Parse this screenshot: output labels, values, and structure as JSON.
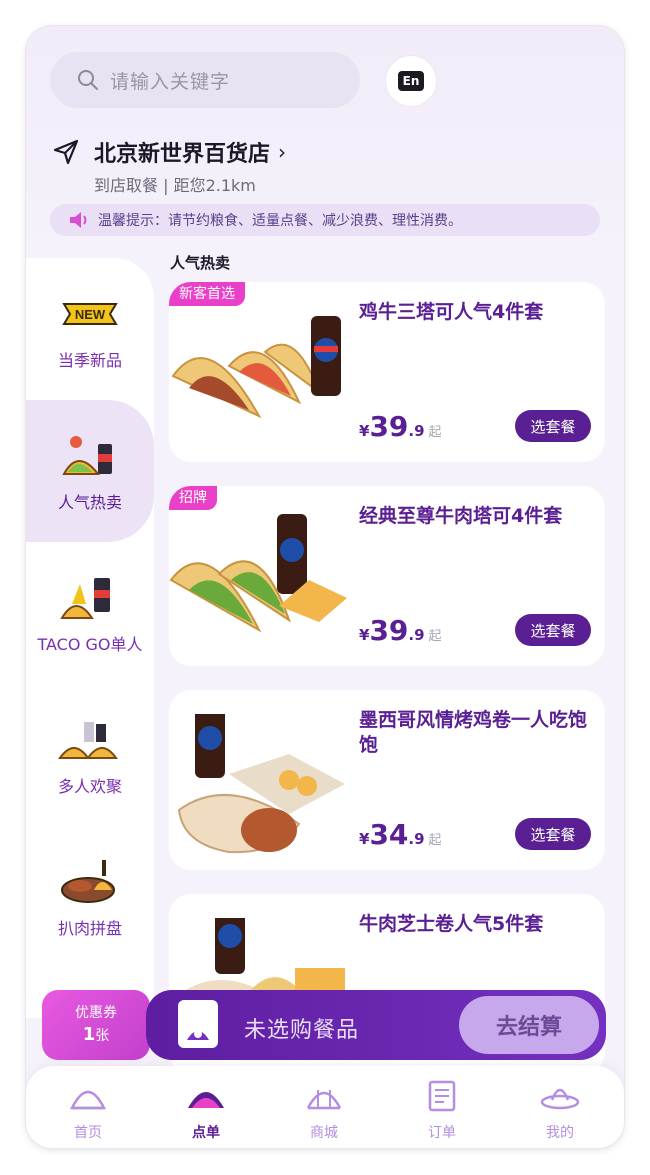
{
  "search": {
    "placeholder": "请输入关键字"
  },
  "lang_button": {
    "label": "En"
  },
  "store": {
    "name": "北京新世界百货店",
    "arrow": "›",
    "sub": "到店取餐 | 距您2.1km"
  },
  "notice": {
    "text": "温馨提示：请节约粮食、适量点餐、减少浪费、理性消费。"
  },
  "section_title": "人气热卖",
  "sidebar": {
    "items": [
      {
        "label": "当季新品",
        "badge": "NEW"
      },
      {
        "label": "人气热卖"
      },
      {
        "label": "TACO GO单人"
      },
      {
        "label": "多人欢聚"
      },
      {
        "label": "扒肉拼盘"
      }
    ],
    "active_index": 1
  },
  "products": [
    {
      "tag": "新客首选",
      "title": "鸡牛三塔可人气4件套",
      "currency": "¥",
      "price_int": "39",
      "price_dec": ".9",
      "suffix": "起",
      "button": "选套餐"
    },
    {
      "tag": "招牌",
      "title": "经典至尊牛肉塔可4件套",
      "currency": "¥",
      "price_int": "39",
      "price_dec": ".9",
      "suffix": "起",
      "button": "选套餐"
    },
    {
      "tag": "",
      "title": "墨西哥风情烤鸡卷一人吃饱饱",
      "currency": "¥",
      "price_int": "34",
      "price_dec": ".9",
      "suffix": "起",
      "button": "选套餐"
    },
    {
      "tag": "",
      "title": "牛肉芝士卷人气5件套",
      "currency": "",
      "price_int": "",
      "price_dec": "",
      "suffix": "",
      "button": ""
    }
  ],
  "coupon": {
    "label": "优惠券",
    "count": "1",
    "unit": "张"
  },
  "cart": {
    "text": "未选购餐品",
    "checkout": "去结算"
  },
  "tabbar": {
    "items": [
      {
        "label": "首页",
        "icon": "home-taco-icon"
      },
      {
        "label": "点单",
        "icon": "order-taco-icon"
      },
      {
        "label": "商城",
        "icon": "mall-icon"
      },
      {
        "label": "订单",
        "icon": "receipt-icon"
      },
      {
        "label": "我的",
        "icon": "sombrero-icon"
      }
    ],
    "active_index": 1
  },
  "colors": {
    "brand": "#5a1f93",
    "accent_pink": "#e840c8",
    "light_purple": "#ece3f7",
    "checkout_bg": "#c7a8ec"
  }
}
